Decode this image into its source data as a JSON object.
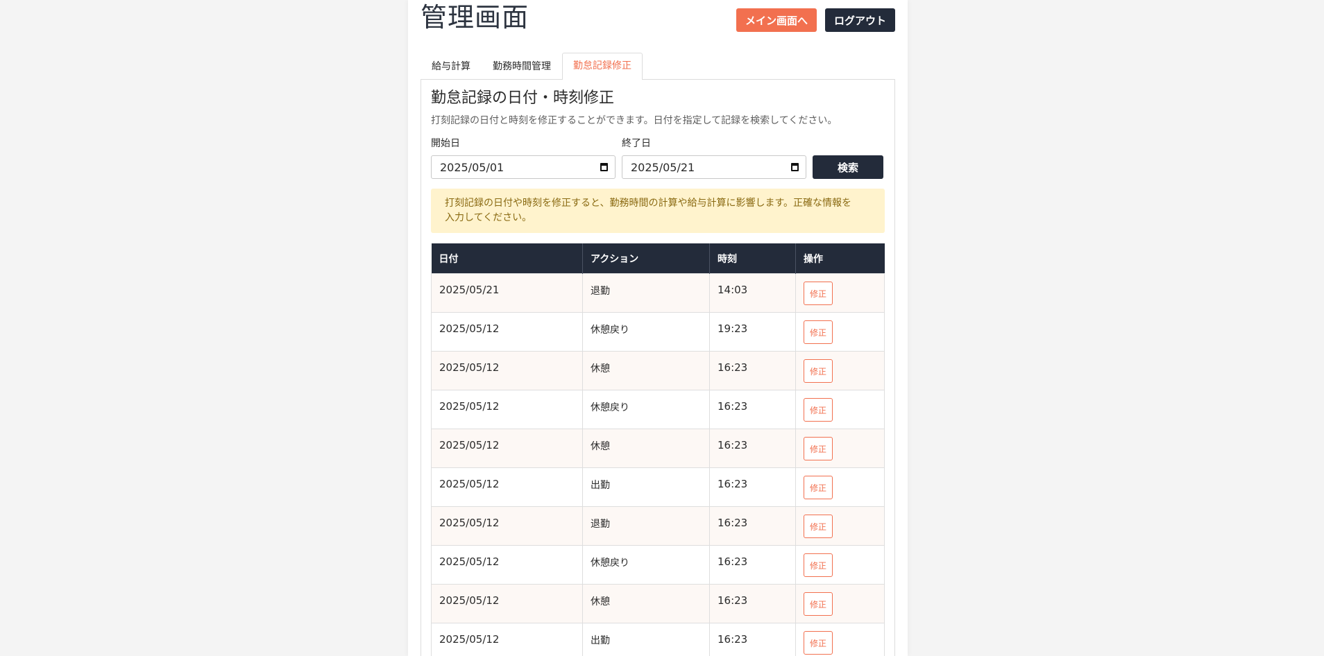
{
  "header": {
    "title": "管理画面",
    "main_button": "メイン画面へ",
    "logout_button": "ログアウト"
  },
  "tabs": [
    {
      "label": "給与計算",
      "active": false
    },
    {
      "label": "勤務時間管理",
      "active": false
    },
    {
      "label": "勤怠記録修正",
      "active": true
    }
  ],
  "section": {
    "title": "勤怠記録の日付・時刻修正",
    "description": "打刻記録の日付と時刻を修正することができます。日付を指定して記録を検索してください。"
  },
  "form": {
    "start_label": "開始日",
    "start_value": "2025/05/01",
    "end_label": "終了日",
    "end_value": "2025/05/21",
    "search_button": "検索"
  },
  "warning": {
    "line1": "打刻記録の日付や時刻を修正すると、勤務時間の計算や給与計算に影響します。正確な情報を",
    "line2": "入力してください。"
  },
  "table": {
    "headers": [
      "日付",
      "アクション",
      "時刻",
      "操作"
    ],
    "edit_label": "修正",
    "rows": [
      {
        "date": "2025/05/21",
        "action": "退勤",
        "time": "14:03"
      },
      {
        "date": "2025/05/12",
        "action": "休憩戻り",
        "time": "19:23"
      },
      {
        "date": "2025/05/12",
        "action": "休憩",
        "time": "16:23"
      },
      {
        "date": "2025/05/12",
        "action": "休憩戻り",
        "time": "16:23"
      },
      {
        "date": "2025/05/12",
        "action": "休憩",
        "time": "16:23"
      },
      {
        "date": "2025/05/12",
        "action": "出勤",
        "time": "16:23"
      },
      {
        "date": "2025/05/12",
        "action": "退勤",
        "time": "16:23"
      },
      {
        "date": "2025/05/12",
        "action": "休憩戻り",
        "time": "16:23"
      },
      {
        "date": "2025/05/12",
        "action": "休憩",
        "time": "16:23"
      },
      {
        "date": "2025/05/12",
        "action": "出勤",
        "time": "16:23"
      }
    ]
  },
  "colors": {
    "accent": "#f2704f",
    "dark": "#232b3a",
    "warning_bg": "#fff3cd",
    "warning_text": "#8a6a12"
  }
}
